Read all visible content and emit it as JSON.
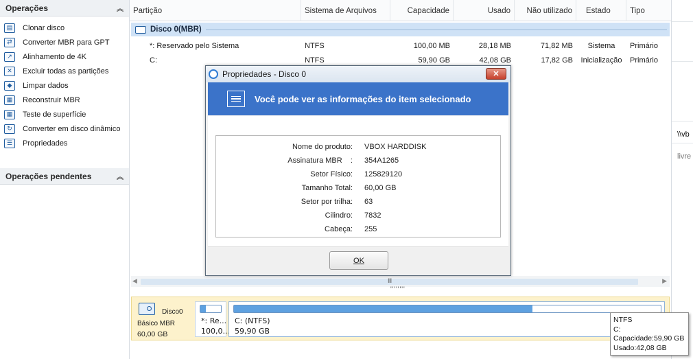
{
  "sidebar": {
    "operations_title": "Operações",
    "pending_title": "Operações pendentes",
    "items": [
      {
        "label": "Clonar disco",
        "icon": "clone-disk-icon"
      },
      {
        "label": "Converter MBR para GPT",
        "icon": "convert-gpt-icon"
      },
      {
        "label": "Alinhamento de 4K",
        "icon": "align-4k-icon"
      },
      {
        "label": "Excluir todas as partições",
        "icon": "delete-partitions-icon"
      },
      {
        "label": "Limpar dados",
        "icon": "eraser-icon"
      },
      {
        "label": "Reconstruir MBR",
        "icon": "rebuild-mbr-icon"
      },
      {
        "label": "Teste de superfície",
        "icon": "surface-test-icon"
      },
      {
        "label": "Converter em disco dinâmico",
        "icon": "dynamic-disk-icon"
      },
      {
        "label": "Propriedades",
        "icon": "properties-icon"
      }
    ]
  },
  "table": {
    "headers": [
      "Partição",
      "Sistema de Arquivos",
      "Capacidade",
      "Usado",
      "Não utilizado",
      "Estado",
      "Tipo"
    ],
    "disk_label": "Disco 0(MBR)",
    "rows": [
      [
        "*: Reservado pelo Sistema",
        "NTFS",
        "100,00 MB",
        "28,18 MB",
        "71,82 MB",
        "Sistema",
        "Primário"
      ],
      [
        "C:",
        "NTFS",
        "59,90 GB",
        "42,08 GB",
        "17,82 GB",
        "Inicialização",
        "Primário"
      ]
    ]
  },
  "diskmap": {
    "name": "Disco0",
    "type": "Básico MBR",
    "size": "60,00 GB",
    "partitions": [
      {
        "line1": "*: Re...",
        "line2": "100,0...",
        "used_fraction": 0.28
      },
      {
        "line1": "C: (NTFS)",
        "line2": "59,90 GB",
        "used_fraction": 0.7
      }
    ]
  },
  "tooltip": {
    "line1": "NTFS",
    "line2": "C:",
    "line3": "Capacidade:59,90 GB",
    "line4": "Usado:42,08 GB"
  },
  "right_pane": {
    "text1": "\\\\vb",
    "text2": "livre"
  },
  "dialog": {
    "title": "Propriedades - Disco 0",
    "close_label": "✕",
    "banner": "Você pode ver as informações do item selecionado",
    "ok_label": "OK",
    "fields": [
      {
        "key": "Nome do produto:",
        "value": "VBOX HARDDISK"
      },
      {
        "key": "Assinatura MBR    :",
        "value": "354A1265"
      },
      {
        "key": "Setor Físico:",
        "value": "125829120"
      },
      {
        "key": "Tamanho Total:",
        "value": "60,00 GB"
      },
      {
        "key": "Setor por trilha:",
        "value": "63"
      },
      {
        "key": "Cilindro:",
        "value": "7832"
      },
      {
        "key": "Cabeça:",
        "value": "255"
      }
    ]
  },
  "colors": {
    "accent": "#3b73c9",
    "disk_row": "#cfe2f6",
    "diskmap_bg": "#fdf2cc",
    "bar_fill": "#5ea1e0"
  }
}
